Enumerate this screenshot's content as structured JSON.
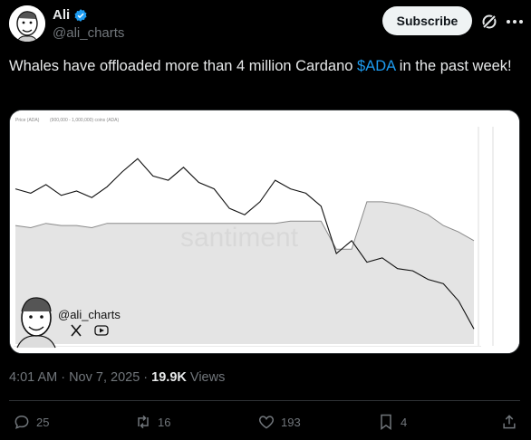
{
  "author": {
    "display_name": "Ali",
    "handle": "@ali_charts",
    "avatar_icon": "cartoon-face-avatar",
    "verified_icon": "verified-badge-icon",
    "verified_color": "#1d9bf0"
  },
  "header": {
    "subscribe_label": "Subscribe",
    "grok_icon": "grok-icon",
    "more_icon": "more-horizontal-icon"
  },
  "tweet": {
    "text_before": "Whales have offloaded more than 4 million Cardano ",
    "cashtag": "$ADA",
    "text_after": " in the past week!",
    "cashtag_color": "#1d9bf0"
  },
  "media": {
    "legend_price": "Price (ADA)",
    "legend_holders": "(900,000 - 1,000,000) coins (ADA)",
    "watermark": "santiment",
    "overlay_handle": "@ali_charts",
    "overlay_icons": [
      "x-logo-icon",
      "youtube-icon"
    ]
  },
  "chart_data": {
    "type": "line",
    "series": [
      {
        "values": [
          0.72,
          0.7,
          0.74,
          0.69,
          0.71,
          0.68,
          0.73,
          0.8,
          0.86,
          0.78,
          0.76,
          0.82,
          0.75,
          0.72,
          0.63,
          0.6,
          0.66,
          0.76,
          0.72,
          0.7,
          0.64,
          0.42,
          0.48,
          0.38,
          0.4,
          0.35,
          0.34,
          0.3,
          0.28,
          0.2,
          0.07
        ]
      },
      {
        "values": [
          0.55,
          0.54,
          0.56,
          0.55,
          0.55,
          0.54,
          0.56,
          0.56,
          0.56,
          0.56,
          0.56,
          0.56,
          0.56,
          0.56,
          0.56,
          0.56,
          0.56,
          0.56,
          0.57,
          0.57,
          0.57,
          0.44,
          0.44,
          0.66,
          0.66,
          0.65,
          0.63,
          0.6,
          0.55,
          0.52,
          0.48
        ]
      }
    ],
    "fill_color": "#e4e4e4",
    "price_line_color": "#111111",
    "holder_line_color": "#8a8a8a"
  },
  "meta": {
    "time": "4:01 AM · Nov 7, 2025 · ",
    "views_count": "19.9K",
    "views_label": " Views"
  },
  "actions": {
    "replies": "25",
    "reposts": "16",
    "likes": "193",
    "bookmarks": "4"
  }
}
